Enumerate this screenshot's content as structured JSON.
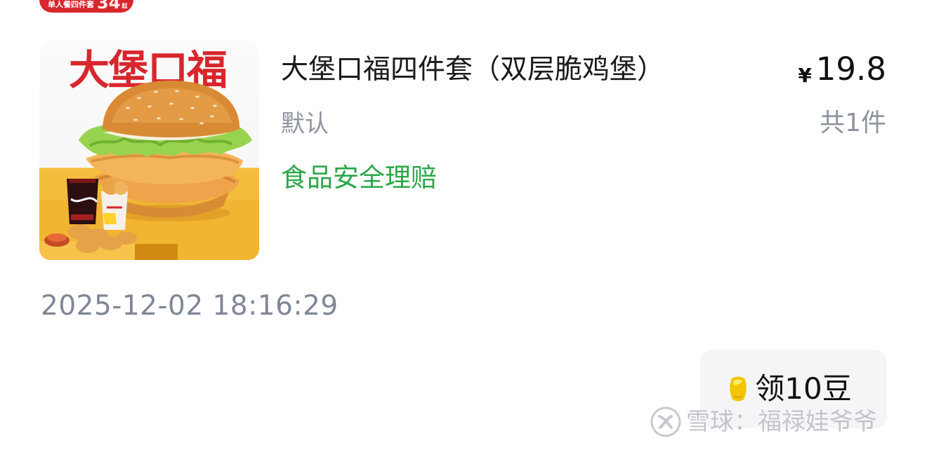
{
  "top_badge": {
    "label": "单人餐四件套",
    "price_fragment": "34",
    "suffix": "起"
  },
  "product": {
    "image": {
      "poster_title": "大堡口福",
      "icon": "burger-meal-image"
    },
    "name": "大堡口福四件套（双层脆鸡堡）",
    "price": {
      "currency": "¥",
      "amount": "19.8"
    },
    "spec": "默认",
    "quantity": "共1件",
    "guarantee": "食品安全理赔"
  },
  "order": {
    "timestamp": "2025-12-02 18:16:29"
  },
  "reward_button": {
    "icon": "coin-icon",
    "label": "领10豆"
  },
  "watermark": {
    "icon": "snowball-icon",
    "text": "雪球：福禄娃爷爷"
  },
  "colors": {
    "brand_red": "#d8262d",
    "green": "#2aa748",
    "gray_text": "#8e949f",
    "button_bg": "#f5f5f7",
    "coin_yellow": "#f4c400"
  }
}
